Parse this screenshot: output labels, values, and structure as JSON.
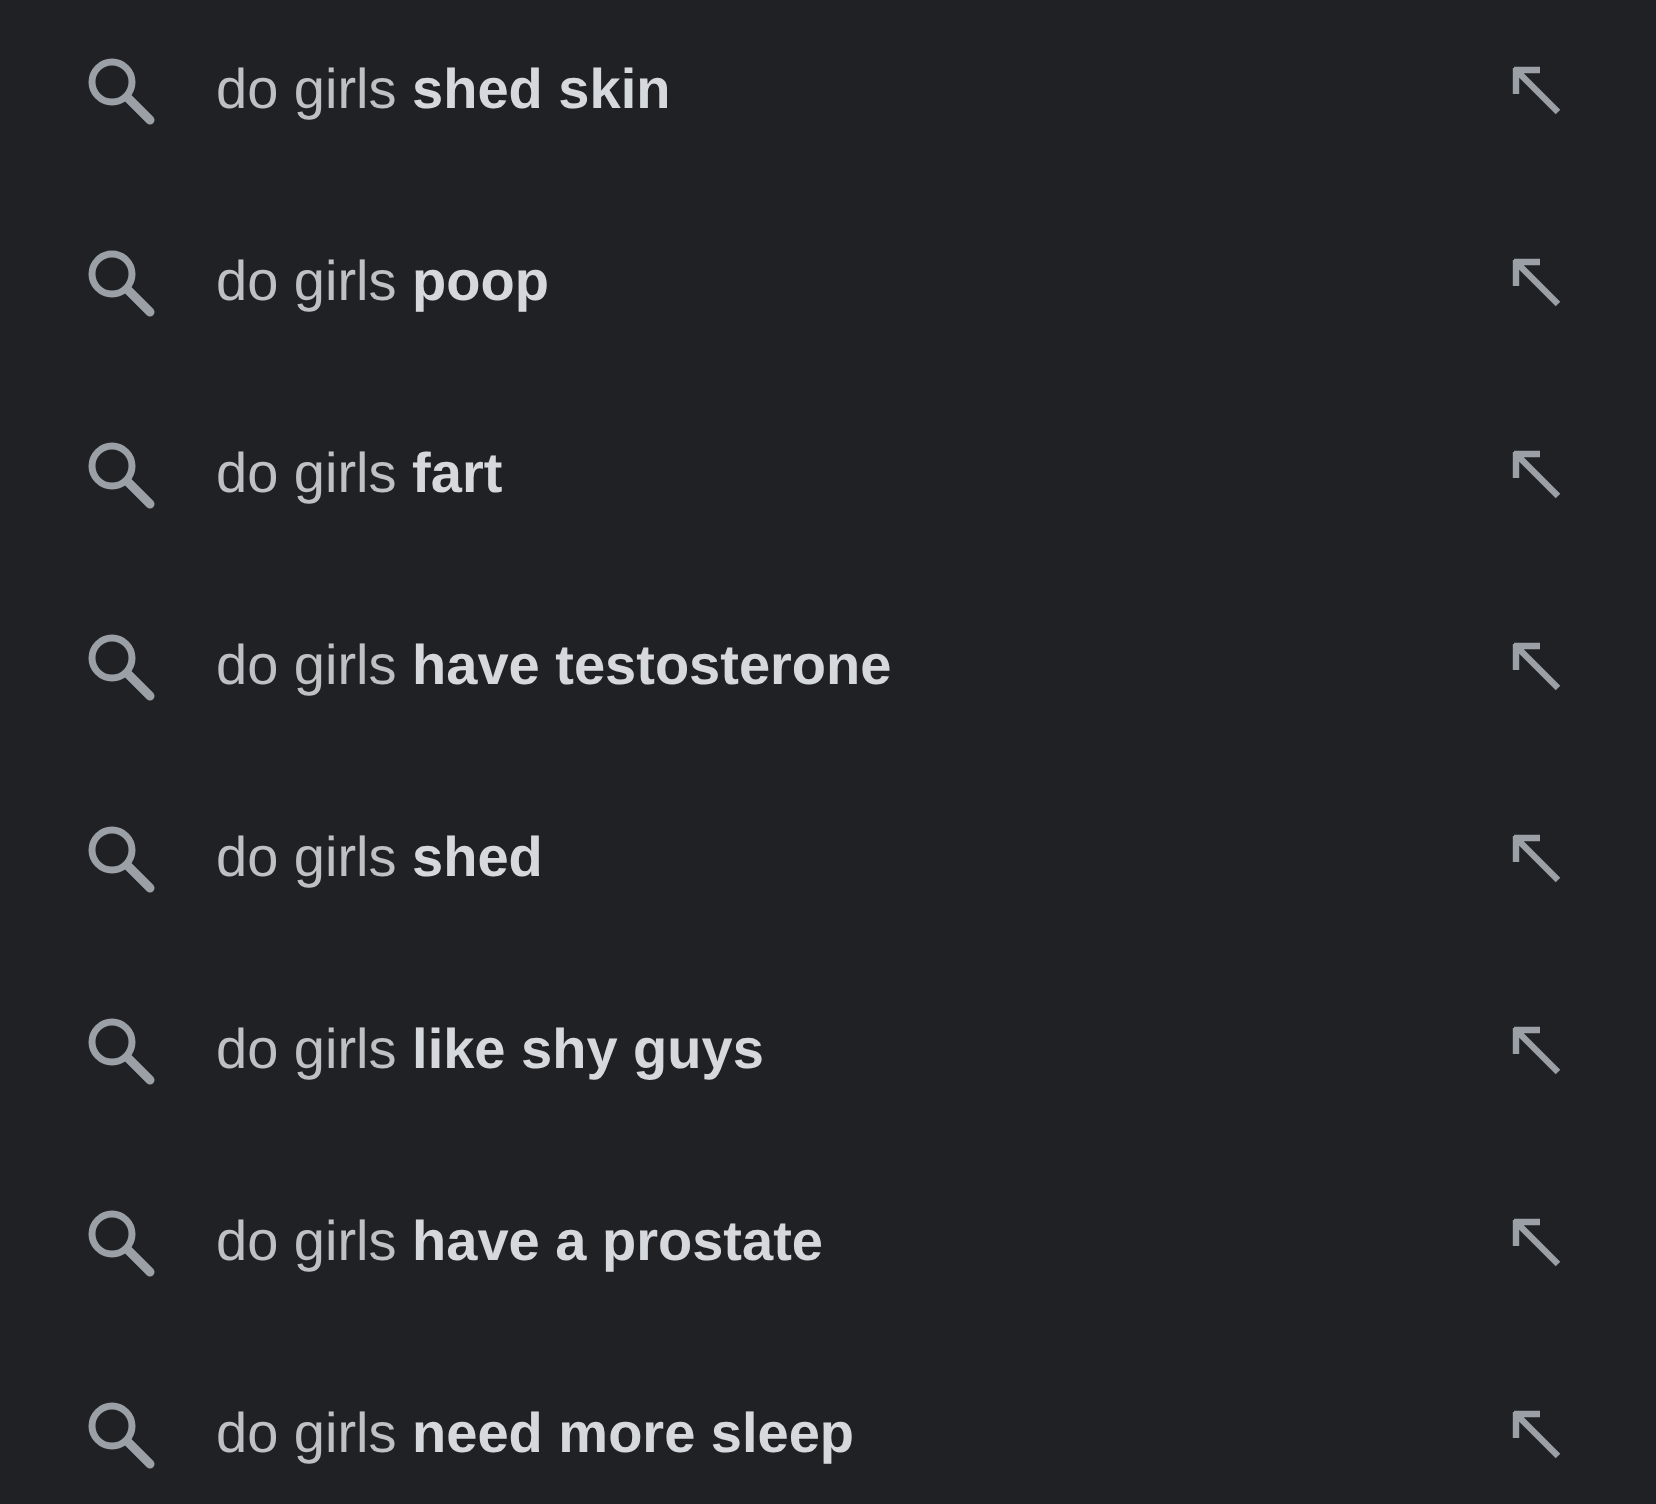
{
  "suggestions": [
    {
      "text": "do girls **shed skin**"
    },
    {
      "text": "do girls **poop**"
    },
    {
      "text": "do girls **fart**"
    },
    {
      "text": "do girls **have testosterone**"
    },
    {
      "text": "do girls **shed**"
    },
    {
      "text": "do girls **like shy guys**"
    },
    {
      "text": "do girls **have a prostate**"
    },
    {
      "text": "do girls **need more sleep**"
    }
  ]
}
